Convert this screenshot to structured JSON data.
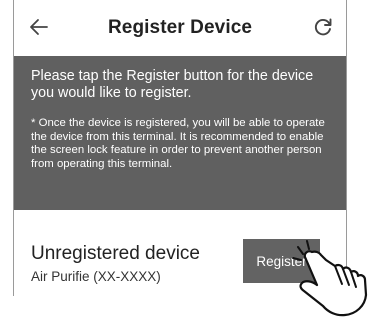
{
  "header": {
    "title": "Register Device",
    "back_icon": "arrow-left-icon",
    "refresh_icon": "refresh-icon"
  },
  "info": {
    "main_text": "Please tap the Register button for the device you would like to register.",
    "note_text": "* Once the device is registered, you will be able to operate the device from this terminal. It is recommended to enable the screen lock feature in order to prevent another person from operating this terminal."
  },
  "device": {
    "name": "Unregistered device",
    "model": "Air Purifie (XX-XXXX)",
    "register_label": "Register"
  },
  "colors": {
    "panel": "#606060",
    "button": "#636363",
    "border": "#9a9a9a"
  },
  "icons": {
    "pointer": "hand-pointer-icon"
  }
}
